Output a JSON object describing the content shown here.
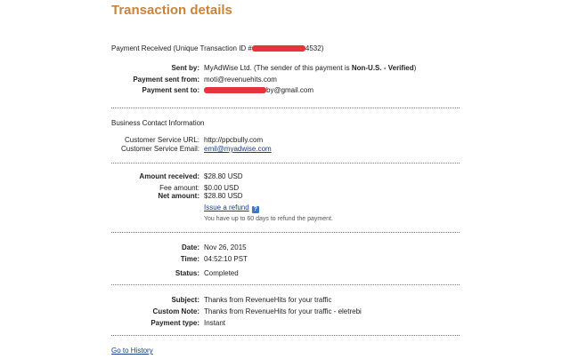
{
  "title": "Transaction details",
  "payment": {
    "heading": "Payment Received",
    "txn_prefix": "(Unique Transaction ID #",
    "txn_suffix": "4532)",
    "sent_by_label": "Sent by:",
    "sent_by_value": "MyAdWise Ltd. (The sender of this payment is ",
    "sent_by_status": "Non-U.S. - Verified",
    "sent_by_close": ")",
    "sent_from_label": "Payment sent from:",
    "sent_from_value": "moti@revenuehits.com",
    "sent_to_label": "Payment sent to:",
    "sent_to_suffix": "by@gmail.com"
  },
  "contact": {
    "heading": "Business Contact Information",
    "url_label": "Customer Service URL:",
    "url_value": "http://ppcbully.com",
    "email_label": "Customer Service Email:",
    "email_value": "emil@myadwise.com"
  },
  "amounts": {
    "received_label": "Amount received:",
    "received_value": "$28.80 USD",
    "fee_label": "Fee amount:",
    "fee_value": "$0.00 USD",
    "net_label": "Net amount:",
    "net_value": "$28.80 USD",
    "refund_link": "Issue a refund",
    "refund_help": "?",
    "refund_note": "You have up to 60 days to refund the payment."
  },
  "status": {
    "date_label": "Date:",
    "date_value": "Nov 26, 2015",
    "time_label": "Time:",
    "time_value": "04:52:10 PST",
    "status_label": "Status:",
    "status_value": "Completed"
  },
  "details": {
    "subject_label": "Subject:",
    "subject_value": "Thanks from RevenueHits for your traffic",
    "note_label": "Custom Note:",
    "note_value": "Thanks from RevenueHits for your traffic - eletrebi",
    "type_label": "Payment type:",
    "type_value": "Instant"
  },
  "footer": {
    "history_link": "Go to History"
  },
  "colors": {
    "title": "#c8843a",
    "redaction": "#e8323c",
    "link": "#1a3c8a"
  }
}
